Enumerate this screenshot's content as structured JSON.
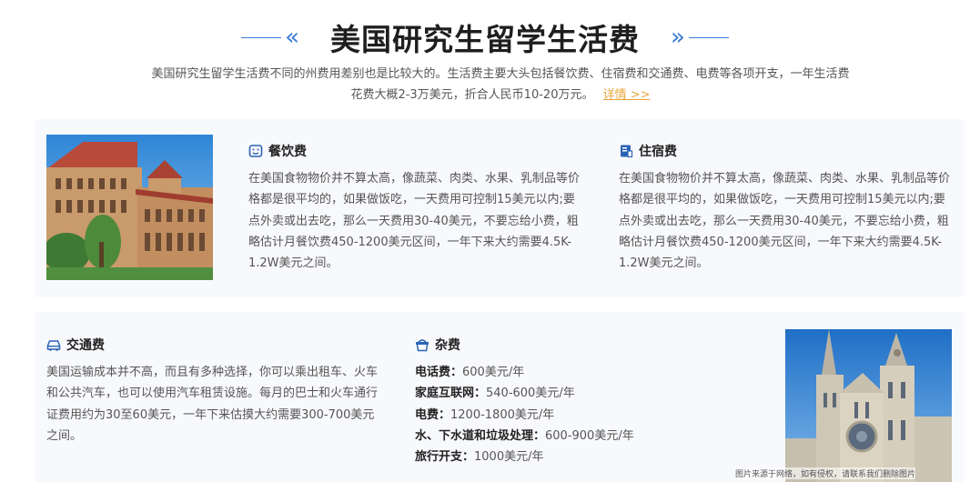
{
  "header": {
    "title": "美国研究生留学生活费",
    "subtitle_line1": "美国研究生留学生活费不同的州费用差别也是比较大的。生活费主要大头包括餐饮费、住宿费和交通费、电费等各项开支，一年生活费",
    "subtitle_line2": "花费大概2-3万美元，折合人民币10-20万元。",
    "more_link": "详情 >>",
    "accent_color": "#3a7bd5",
    "link_color": "#e8a73a"
  },
  "sections": {
    "food": {
      "icon": "smile-food-icon",
      "title": "餐饮费",
      "body": "在美国食物物价并不算太高，像蔬菜、肉类、水果、乳制品等价格都是很平均的，如果做饭吃，一天费用可控制15美元以内;要点外卖或出去吃，那么一天费用30-40美元，不要忘给小费，粗略估计月餐饮费450-1200美元区间，一年下来大约需要4.5K-1.2W美元之间。"
    },
    "housing": {
      "icon": "building-icon",
      "title": "住宿费",
      "body": "在美国食物物价并不算太高，像蔬菜、肉类、水果、乳制品等价格都是很平均的，如果做饭吃，一天费用可控制15美元以内;要点外卖或出去吃，那么一天费用30-40美元，不要忘给小费，粗略估计月餐饮费450-1200美元区间，一年下来大约需要4.5K-1.2W美元之间。"
    },
    "transport": {
      "icon": "car-icon",
      "title": "交通费",
      "body": "美国运输成本并不高，而且有多种选择，你可以乘出租车、火车和公共汽车，也可以使用汽车租赁设施。每月的巴士和火车通行证费用约为30至60美元，一年下来估摸大约需要300-700美元之间。"
    },
    "misc": {
      "icon": "basket-icon",
      "title": "杂费",
      "items": [
        {
          "label": "电话费：",
          "value": "600美元/年"
        },
        {
          "label": "家庭互联网：",
          "value": "540-600美元/年"
        },
        {
          "label": "电费：",
          "value": "1200-1800美元/年"
        },
        {
          "label": "水、下水道和垃圾处理：",
          "value": "600-900美元/年"
        },
        {
          "label": "旅行开支：",
          "value": "1000美元/年"
        }
      ]
    }
  },
  "images": {
    "campus_building": "campus-building-photo",
    "church": "gothic-church-photo",
    "caption": "图片来源于网络，如有侵权，请联系我们删除图片"
  }
}
